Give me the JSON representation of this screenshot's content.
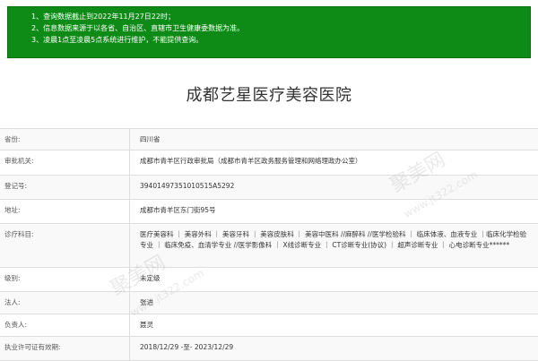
{
  "notice": {
    "lines": [
      "1、查询数据截止到2022年11月27日22时；",
      "2、信息数据来源于以各省、自治区、直辖市卫生健康委数据为准。",
      "3、凌晨1点至凌晨5点系统进行维护，不能提供查询。"
    ]
  },
  "title": "成都艺星医疗美容医院",
  "rows": [
    {
      "label": "省份:",
      "value": "四川省"
    },
    {
      "label": "审批机关:",
      "value": "成都市青羊区行政审批局（成都市青羊区政务服务管理和网络理政办公室）"
    },
    {
      "label": "登记号:",
      "value": "39401497351010515A5292"
    },
    {
      "label": "地址:",
      "value": "成都市青羊区东门街95号"
    },
    {
      "label": "诊疗科目:",
      "value": "医疗美容科 ｜ 美容外科 ｜ 美容牙科 ｜ 美容皮肤科 ｜ 美容中医科 //麻醉科 //医学检验科 ｜ 临床体液、血液专业 ｜临床化学检验专业 ｜ 临床免疫、血清学专业 //医学影像科 ｜ X线诊断专业 ｜ CT诊断专业(协议) ｜ 超声诊断专业 ｜ 心电诊断专业******"
    },
    {
      "label": "级别:",
      "value": "未定级"
    },
    {
      "label": "法人:",
      "value": "张进"
    },
    {
      "label": "负责人:",
      "value": "聂灵"
    },
    {
      "label": "执业许可证有效期:",
      "value": "2018/12/29 -至- 2023/12/29"
    }
  ],
  "watermark": {
    "brand": "聚美网",
    "site": "www.jt322.com"
  }
}
